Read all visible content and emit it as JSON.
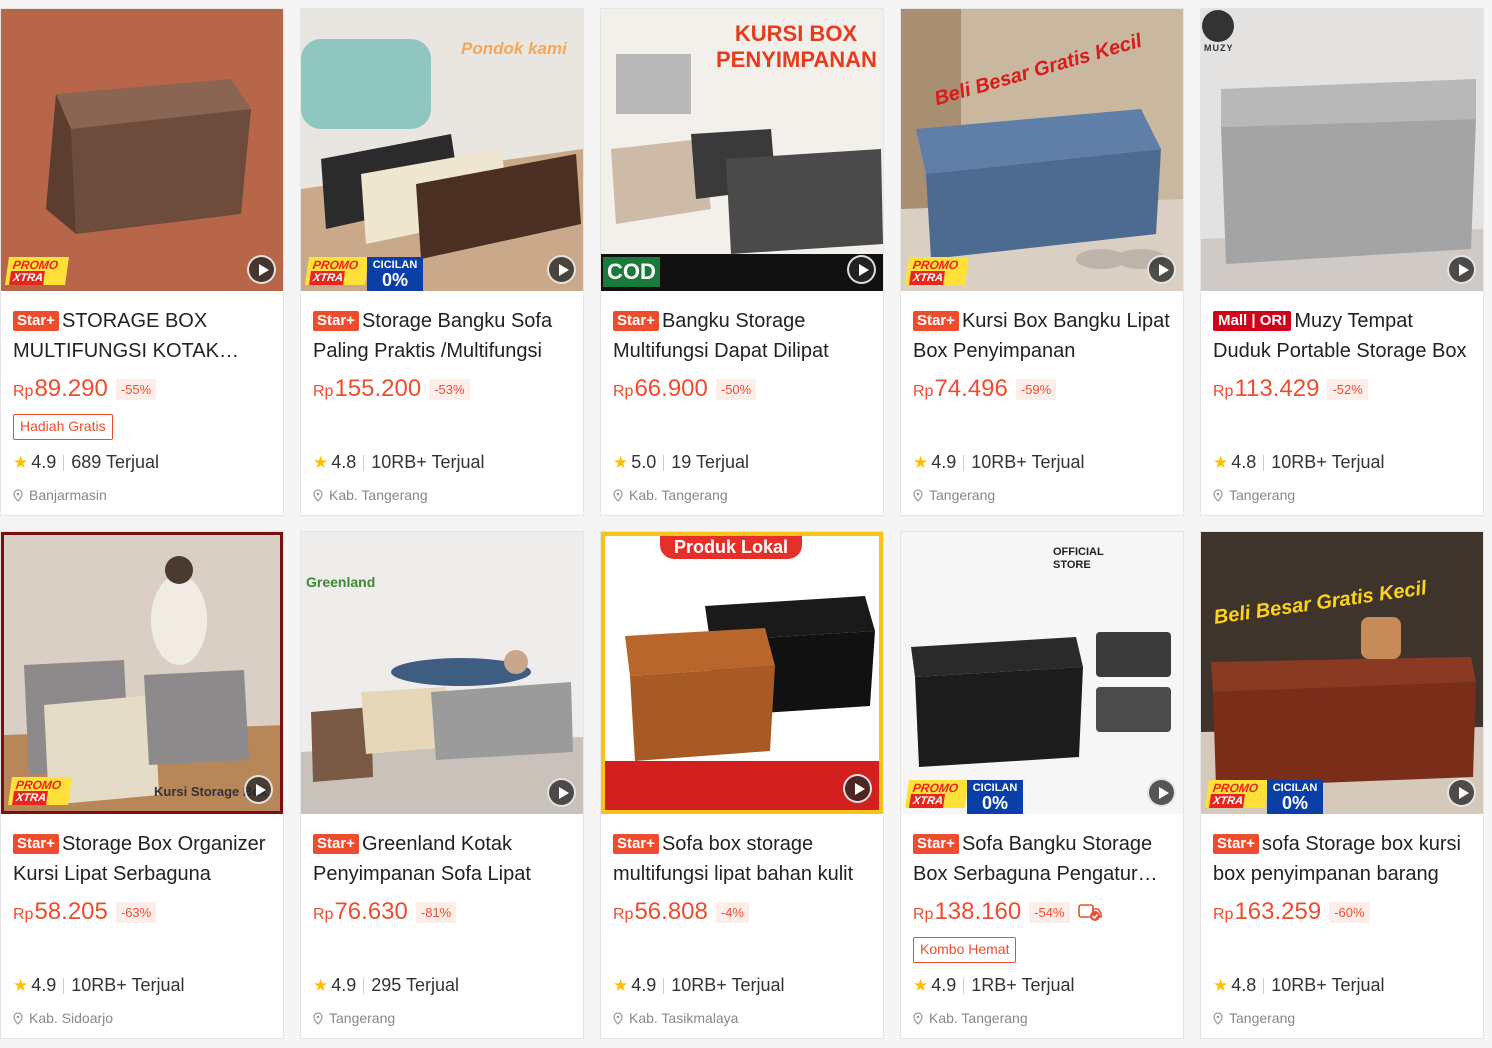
{
  "products": [
    {
      "badge": "Star+",
      "title": "STORAGE BOX MULTIFUNGSI KOTAK PENYIMPANAN",
      "rp": "Rp",
      "price": "89.290",
      "discount": "-55%",
      "tag": "Hadiah Gratis",
      "rating": "4.9",
      "sold": "689 Terjual",
      "location": "Banjarmasin",
      "overlay": "promo",
      "img_text": ""
    },
    {
      "badge": "Star+",
      "title": "Storage Bangku Sofa Paling Praktis /Multifungsi",
      "rp": "Rp",
      "price": "155.200",
      "discount": "-53%",
      "tag": "",
      "rating": "4.8",
      "sold": "10RB+ Terjual",
      "location": "Kab. Tangerang",
      "overlay": "promo-cicilan",
      "img_text": "Pondok kami"
    },
    {
      "badge": "Star+",
      "title": "Bangku Storage Multifungsi Dapat Dilipat",
      "rp": "Rp",
      "price": "66.900",
      "discount": "-50%",
      "tag": "",
      "rating": "5.0",
      "sold": "19 Terjual",
      "location": "Kab. Tangerang",
      "overlay": "cod",
      "img_text": "KURSI BOX PENYIMPANAN"
    },
    {
      "badge": "Star+",
      "title": "Kursi Box Bangku Lipat Box Penyimpanan",
      "rp": "Rp",
      "price": "74.496",
      "discount": "-59%",
      "tag": "",
      "rating": "4.9",
      "sold": "10RB+ Terjual",
      "location": "Tangerang",
      "overlay": "promo",
      "img_text": "Beli Besar Gratis Kecil"
    },
    {
      "badge": "Mall | ORI",
      "title": "Muzy Tempat Duduk Portable Storage Box",
      "rp": "Rp",
      "price": "113.429",
      "discount": "-52%",
      "tag": "",
      "rating": "4.8",
      "sold": "10RB+ Terjual",
      "location": "Tangerang",
      "overlay": "none",
      "img_text": "MUZY"
    },
    {
      "badge": "Star+",
      "title": "Storage Box Organizer Kursi Lipat Serbaguna",
      "rp": "Rp",
      "price": "58.205",
      "discount": "-63%",
      "tag": "",
      "rating": "4.9",
      "sold": "10RB+ Terjual",
      "location": "Kab. Sidoarjo",
      "overlay": "promo",
      "img_text": "Kursi Storage Box"
    },
    {
      "badge": "Star+",
      "title": "Greenland Kotak Penyimpanan Sofa Lipat",
      "rp": "Rp",
      "price": "76.630",
      "discount": "-81%",
      "tag": "",
      "rating": "4.9",
      "sold": "295 Terjual",
      "location": "Tangerang",
      "overlay": "none",
      "img_text": "Greenland"
    },
    {
      "badge": "Star+",
      "title": "Sofa box storage multifungsi lipat bahan kulit",
      "rp": "Rp",
      "price": "56.808",
      "discount": "-4%",
      "tag": "",
      "rating": "4.9",
      "sold": "10RB+ Terjual",
      "location": "Kab. Tasikmalaya",
      "overlay": "none",
      "img_text": "Produk Lokal"
    },
    {
      "badge": "Star+",
      "title": "Sofa Bangku Storage Box Serbaguna Pengatur Ruang",
      "rp": "Rp",
      "price": "138.160",
      "discount": "-54%",
      "tag": "Kombo Hemat",
      "rating": "4.9",
      "sold": "1RB+ Terjual",
      "location": "Kab. Tangerang",
      "overlay": "promo-cicilan",
      "img_text": "OFFICIAL STORE"
    },
    {
      "badge": "Star+",
      "title": "sofa Storage box kursi box penyimpanan barang",
      "rp": "Rp",
      "price": "163.259",
      "discount": "-60%",
      "tag": "",
      "rating": "4.8",
      "sold": "10RB+ Terjual",
      "location": "Tangerang",
      "overlay": "promo-cicilan",
      "img_text": "Beli Besar Gratis Kecil"
    }
  ],
  "labels": {
    "promo1": "PROMO",
    "promo2": "XTRA",
    "cicilan1": "CICILAN",
    "cicilan2": "0%",
    "cod": "COD"
  },
  "colors": {
    "accent": "#ee4d2d",
    "mall": "#d0011b",
    "star": "#ffbf00"
  }
}
